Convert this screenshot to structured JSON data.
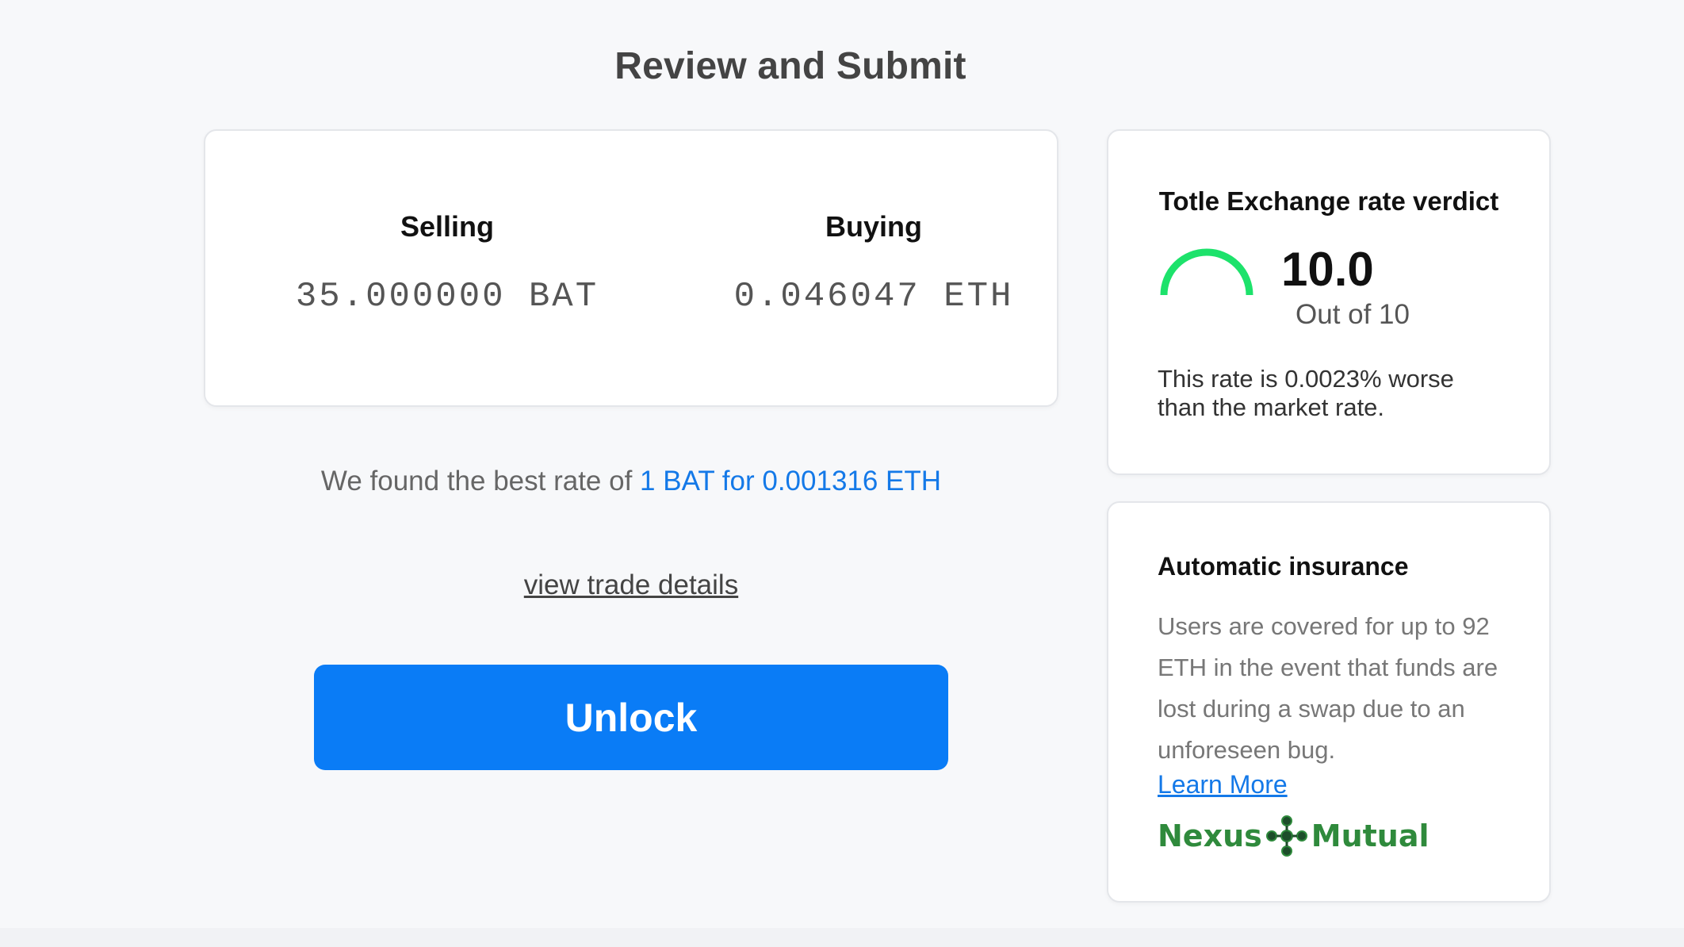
{
  "page": {
    "title": "Review and Submit"
  },
  "trade": {
    "selling_label": "Selling",
    "selling_amount": "35.000000 BAT",
    "buying_label": "Buying",
    "buying_amount": "0.046047 ETH"
  },
  "rate": {
    "prefix": "We found the best rate of ",
    "value": "1 BAT for 0.001316 ETH"
  },
  "links": {
    "view_trade_details": "view trade details"
  },
  "actions": {
    "unlock_label": "Unlock"
  },
  "verdict": {
    "title": "Totle Exchange rate verdict",
    "score": "10.0",
    "score_fraction": 1.0,
    "out_of": "Out of 10",
    "note": "This rate is 0.0023% worse than the market rate.",
    "gauge_color": "#1de26b"
  },
  "insurance": {
    "title": "Automatic insurance",
    "body": "Users are covered for up to 92 ETH in the event that funds are lost during a swap due to an unforeseen bug.",
    "learn_more": "Learn More",
    "logo_left": "Nexus",
    "logo_right": "Mutual",
    "logo_icon": "nexus-mutual-logo-icon"
  },
  "colors": {
    "accent": "#0a7cf6",
    "link": "#1479e8",
    "brand_green": "#2f8a3c"
  }
}
